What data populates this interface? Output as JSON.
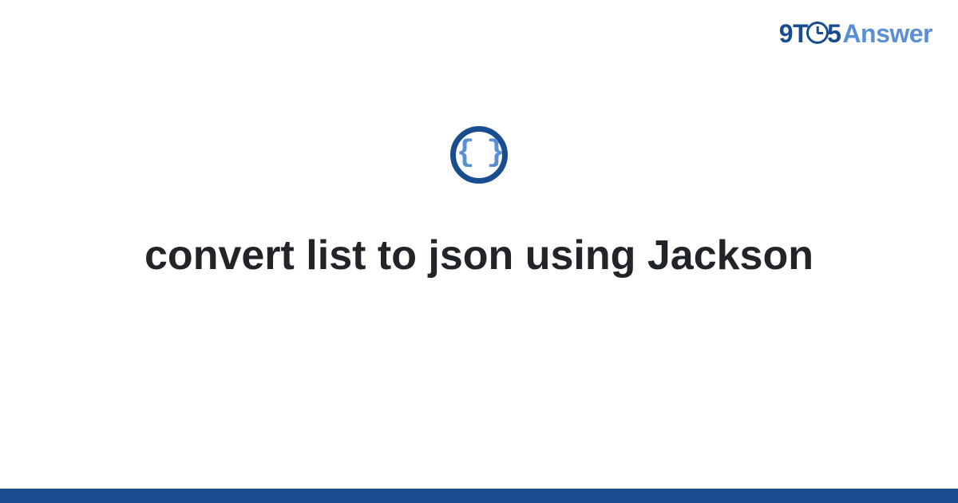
{
  "logo": {
    "part1": "9T",
    "part2": "5",
    "part3": "Answer"
  },
  "icon": {
    "name": "code-braces-icon",
    "glyph": "{ }"
  },
  "title": "convert list to json using Jackson",
  "colors": {
    "brand_dark": "#1a4d8f",
    "brand_light": "#5a8fd4"
  }
}
